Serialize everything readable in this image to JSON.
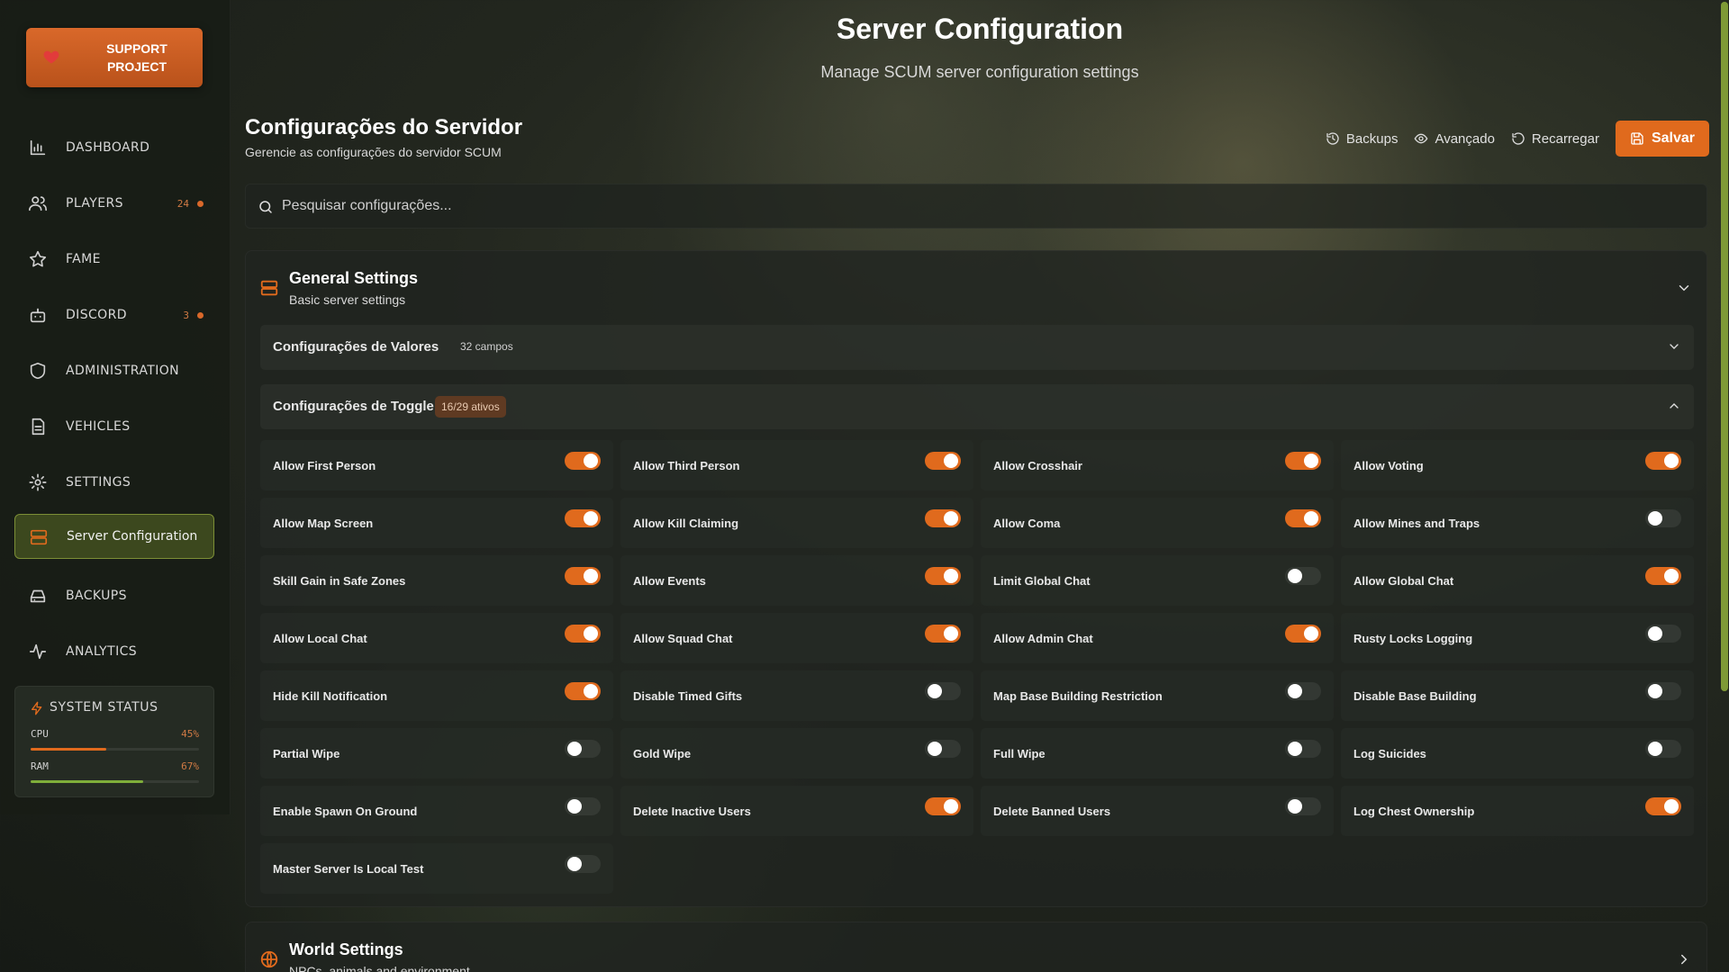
{
  "sidebar": {
    "support": {
      "label": "SUPPORT\nPROJECT"
    },
    "items": [
      {
        "label": "DASHBOARD",
        "icon": "chart-bar-icon"
      },
      {
        "label": "PLAYERS",
        "icon": "users-icon",
        "count": "24"
      },
      {
        "label": "FAME",
        "icon": "star-icon"
      },
      {
        "label": "DISCORD",
        "icon": "bot-icon",
        "count": "3"
      },
      {
        "label": "ADMINISTRATION",
        "icon": "shield-icon"
      },
      {
        "label": "VEHICLES",
        "icon": "document-icon"
      },
      {
        "label": "SETTINGS",
        "icon": "gear-icon"
      },
      {
        "label": "Server Configuration",
        "icon": "server-icon",
        "active": true
      },
      {
        "label": "BACKUPS",
        "icon": "hard-drive-icon"
      },
      {
        "label": "ANALYTICS",
        "icon": "activity-icon"
      }
    ],
    "status": {
      "title": "SYSTEM STATUS",
      "metrics": [
        {
          "label": "CPU",
          "value": "45%",
          "fraction": 0.45,
          "color": "#e06a1d"
        },
        {
          "label": "RAM",
          "value": "67%",
          "fraction": 0.67,
          "color": "#7fae3a"
        }
      ]
    }
  },
  "header": {
    "title": "Server Configuration",
    "subtitle": "Manage SCUM server configuration settings"
  },
  "section": {
    "title": "Configurações do Servidor",
    "subtitle": "Gerencie as configurações do servidor SCUM"
  },
  "toolbar": {
    "backups_label": "Backups",
    "advanced_label": "Avançado",
    "reload_label": "Recarregar",
    "save_label": "Salvar"
  },
  "search": {
    "placeholder": "Pesquisar configurações...",
    "value": ""
  },
  "general": {
    "title": "General Settings",
    "subtitle": "Basic server settings",
    "values_group": {
      "title": "Configurações de Valores",
      "meta": "32 campos"
    },
    "toggle_group": {
      "title": "Configurações de Toggle",
      "badge": "16/29 ativos"
    },
    "toggles": [
      {
        "label": "Allow First Person",
        "on": true
      },
      {
        "label": "Allow Third Person",
        "on": true
      },
      {
        "label": "Allow Crosshair",
        "on": true
      },
      {
        "label": "Allow Voting",
        "on": true
      },
      {
        "label": "Allow Map Screen",
        "on": true
      },
      {
        "label": "Allow Kill Claiming",
        "on": true
      },
      {
        "label": "Allow Coma",
        "on": true
      },
      {
        "label": "Allow Mines and Traps",
        "on": false
      },
      {
        "label": "Skill Gain in Safe Zones",
        "on": true
      },
      {
        "label": "Allow Events",
        "on": true
      },
      {
        "label": "Limit Global Chat",
        "on": false
      },
      {
        "label": "Allow Global Chat",
        "on": true
      },
      {
        "label": "Allow Local Chat",
        "on": true
      },
      {
        "label": "Allow Squad Chat",
        "on": true
      },
      {
        "label": "Allow Admin Chat",
        "on": true
      },
      {
        "label": "Rusty Locks Logging",
        "on": false
      },
      {
        "label": "Hide Kill Notification",
        "on": true
      },
      {
        "label": "Disable Timed Gifts",
        "on": false
      },
      {
        "label": "Map Base Building Restriction",
        "on": false
      },
      {
        "label": "Disable Base Building",
        "on": false
      },
      {
        "label": "Partial Wipe",
        "on": false
      },
      {
        "label": "Gold Wipe",
        "on": false
      },
      {
        "label": "Full Wipe",
        "on": false
      },
      {
        "label": "Log Suicides",
        "on": false
      },
      {
        "label": "Enable Spawn On Ground",
        "on": false
      },
      {
        "label": "Delete Inactive Users",
        "on": true
      },
      {
        "label": "Delete Banned Users",
        "on": false
      },
      {
        "label": "Log Chest Ownership",
        "on": true
      },
      {
        "label": "Master Server Is Local Test",
        "on": false
      }
    ]
  },
  "world": {
    "title": "World Settings",
    "subtitle": "NPCs, animals and environment"
  },
  "colors": {
    "accent": "#e06a1d",
    "active_nav": "#7c8f36"
  }
}
